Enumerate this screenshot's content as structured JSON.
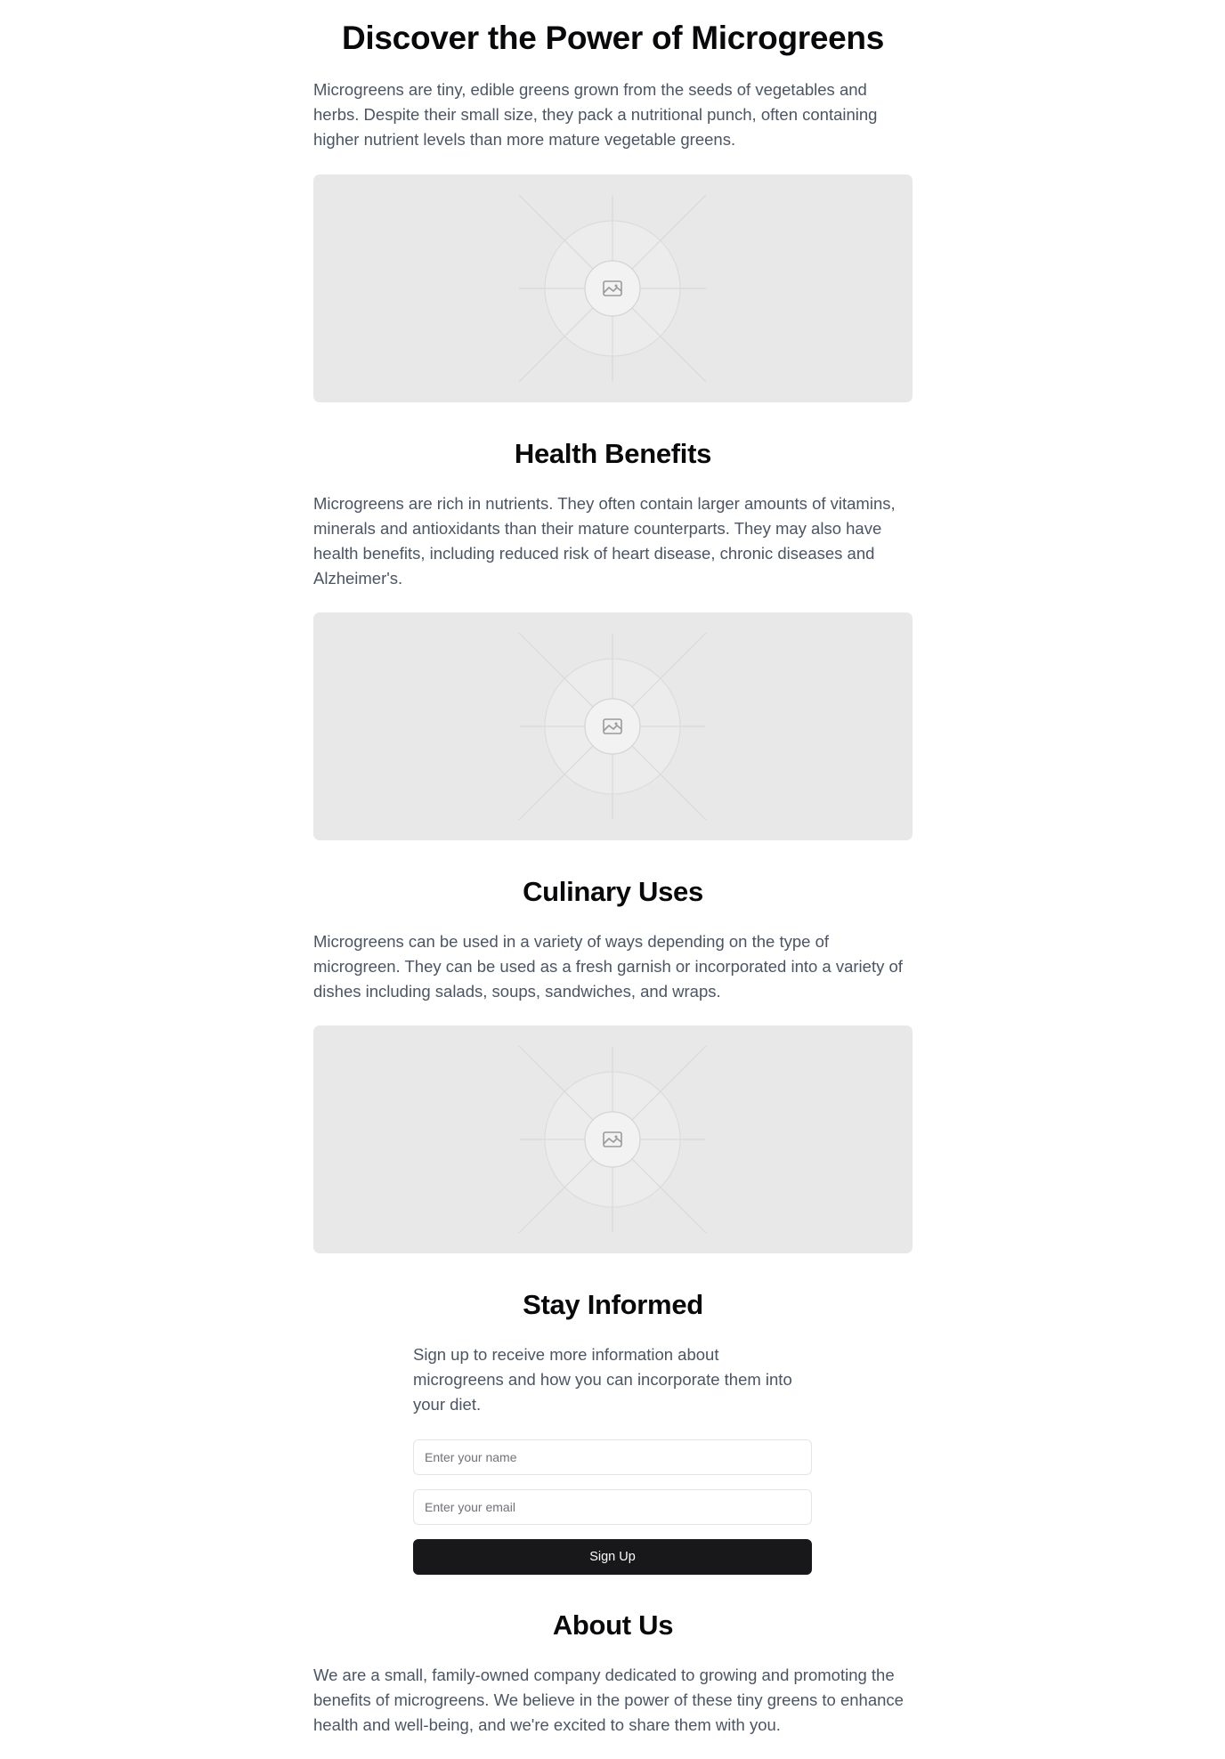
{
  "hero": {
    "title": "Discover the Power of Microgreens",
    "text": "Microgreens are tiny, edible greens grown from the seeds of vegetables and herbs. Despite their small size, they pack a nutritional punch, often containing higher nutrient levels than more mature vegetable greens.",
    "image_icon": "image-placeholder-icon"
  },
  "health": {
    "title": "Health Benefits",
    "text": "Microgreens are rich in nutrients. They often contain larger amounts of vitamins, minerals and antioxidants than their mature counterparts. They may also have health benefits, including reduced risk of heart disease, chronic diseases and Alzheimer's.",
    "image_icon": "image-placeholder-icon"
  },
  "culinary": {
    "title": "Culinary Uses",
    "text": "Microgreens can be used in a variety of ways depending on the type of microgreen. They can be used as a fresh garnish or incorporated into a variety of dishes including salads, soups, sandwiches, and wraps.",
    "image_icon": "image-placeholder-icon"
  },
  "signup": {
    "title": "Stay Informed",
    "text": "Sign up to receive more information about microgreens and how you can incorporate them into your diet.",
    "name_placeholder": "Enter your name",
    "name_value": "",
    "email_placeholder": "Enter your email",
    "email_value": "",
    "button_label": "Sign Up"
  },
  "about": {
    "title": "About Us",
    "text": "We are a small, family-owned company dedicated to growing and promoting the benefits of microgreens. We believe in the power of these tiny greens to enhance health and well-being, and we're excited to share them with you."
  },
  "colors": {
    "text_primary": "#09090b",
    "text_body": "#4b5563",
    "placeholder_bg": "#e8e8e8",
    "button_bg": "#18181b",
    "button_text": "#fafafa"
  }
}
